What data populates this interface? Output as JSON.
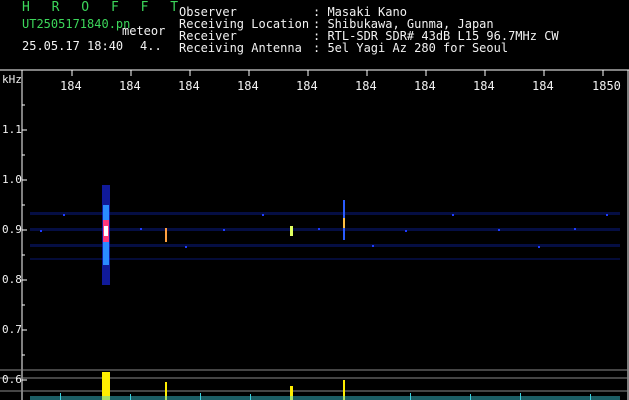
{
  "brand": "H R O F F T",
  "file_name": "UT2505171840.pn",
  "mode_tag": "meteor",
  "date_time": "25.05.17 18:40",
  "minute_mark": "4..",
  "header": [
    {
      "label": "Observer",
      "value": ": Masaki Kano"
    },
    {
      "label": "Receiving Location",
      "value": ": Shibukawa, Gunma, Japan"
    },
    {
      "label": "Receiver",
      "value": ": RTL-SDR SDR# 43dB L15 96.7MHz CW"
    },
    {
      "label": "Receiving Antenna",
      "value": ": 5el Yagi Az 280 for Seoul"
    }
  ],
  "x_axis": {
    "ticks": [
      "184",
      "184",
      "184",
      "184",
      "184",
      "184",
      "184",
      "184",
      "184",
      "1850"
    ]
  },
  "y_axis": {
    "unit": "kHz",
    "ticks": [
      "1.1",
      "1.0",
      "0.9",
      "0.8",
      "0.7",
      "0.6"
    ]
  },
  "colors": {
    "text_green": "#3cd65a",
    "text_white": "#f2f2f2",
    "grid": "#ffffff",
    "signal_yellow": "#ffee00",
    "signal_cyan": "#3fd0e0"
  }
}
